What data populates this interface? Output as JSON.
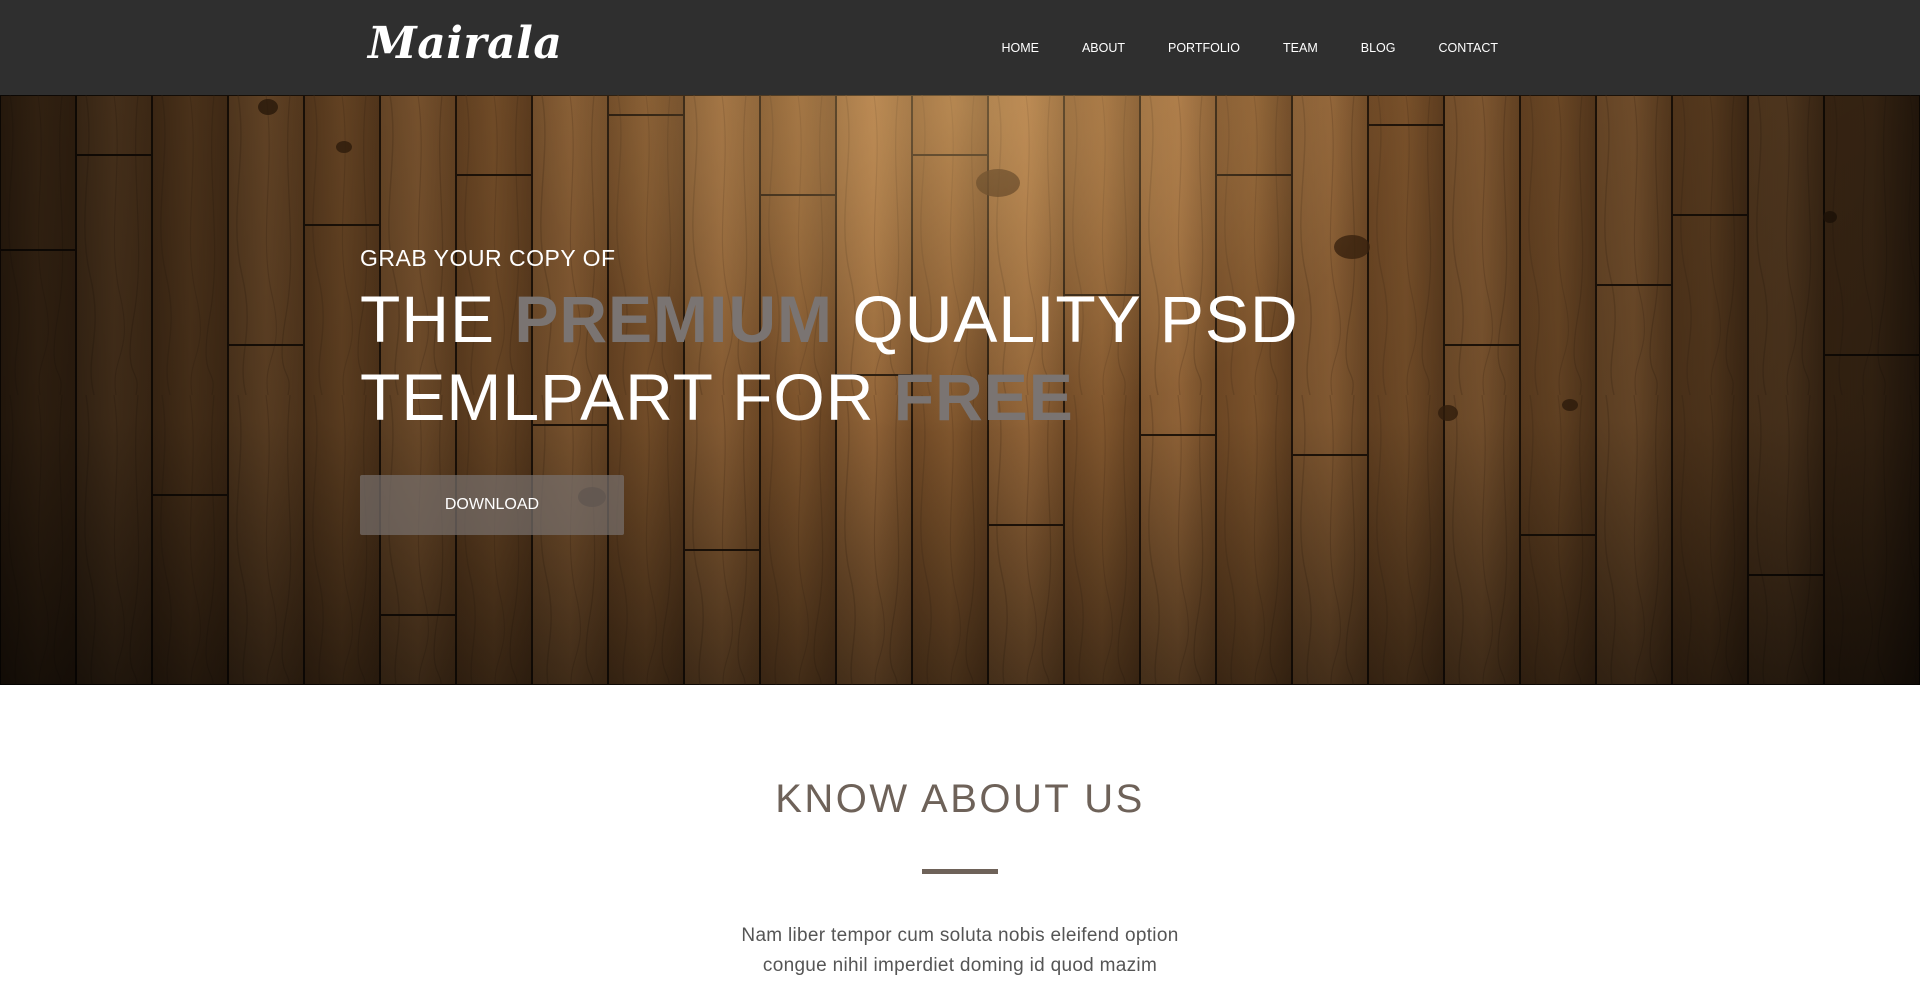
{
  "brand": {
    "logo_text": "Mairala"
  },
  "nav": {
    "items": [
      {
        "label": "HOME"
      },
      {
        "label": "ABOUT"
      },
      {
        "label": "PORTFOLIO"
      },
      {
        "label": "TEAM"
      },
      {
        "label": "BLOG"
      },
      {
        "label": "CONTACT"
      }
    ]
  },
  "hero": {
    "eyebrow": "GRAB YOUR COPY OF",
    "title_line1_part1": "THE ",
    "title_line1_accent": "PREMIUM",
    "title_line1_part2": " QUALITY PSD",
    "title_line2_part1": "TEMLPART FOR ",
    "title_line2_accent": "FREE",
    "download_label": "DOWNLOAD"
  },
  "about": {
    "title": "KNOW ABOUT US",
    "text_line1": "Nam liber tempor cum soluta nobis eleifend option",
    "text_line2": "congue nihil imperdiet doming id quod mazim"
  },
  "colors": {
    "header_bg": "#2f2f2f",
    "accent_gray": "#7a7472",
    "about_heading": "#6e6259"
  }
}
